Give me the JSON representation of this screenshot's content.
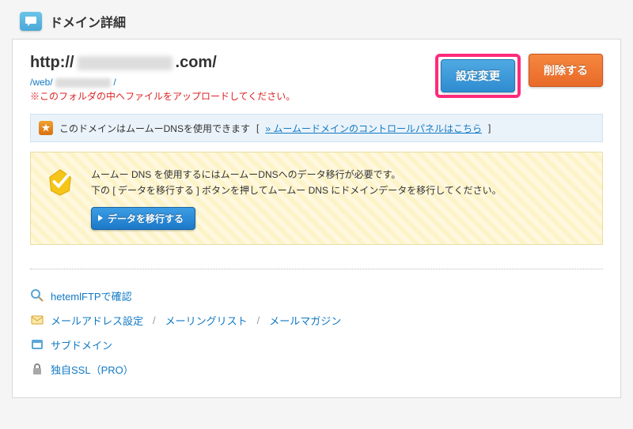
{
  "header": {
    "title": "ドメイン詳細"
  },
  "domain": {
    "url_prefix": "http://",
    "url_suffix": ".com/",
    "web_path_prefix": "/web/",
    "web_path_suffix": "/",
    "upload_note": "※このフォルダの中へファイルをアップロードしてください。"
  },
  "actions": {
    "change_settings": "設定変更",
    "delete": "削除する"
  },
  "dns_bar": {
    "text": "このドメインはムームーDNSを使用できます",
    "link_prefix": "[ ",
    "link": "» ムームードメインのコントロールパネルはこちら",
    "link_suffix": " ]"
  },
  "migrate": {
    "line1": "ムームー DNS を使用するにはムームーDNSへのデータ移行が必要です。",
    "line2": "下の [ データを移行する ] ボタンを押してムームー DNS にドメインデータを移行してください。",
    "button": "データを移行する"
  },
  "links": {
    "ftp": "hetemlFTPで確認",
    "mail_address": "メールアドレス設定",
    "mailing_list": "メーリングリスト",
    "mail_magazine": "メールマガジン",
    "subdomain": "サブドメイン",
    "ssl": "独自SSL（PRO）",
    "sep": "/"
  }
}
